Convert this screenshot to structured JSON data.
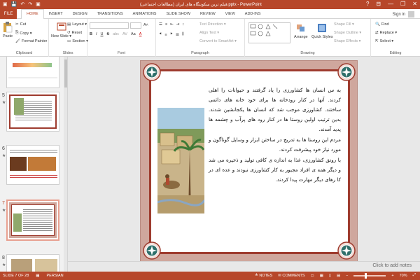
{
  "window": {
    "title": "فیلم ترین سکونتگاه های ایران (مطالعات اجتماعی).pptx - PowerPoint",
    "minimize": "—",
    "restore": "❐",
    "close": "✕",
    "help": "?"
  },
  "qat": {
    "save": "💾",
    "undo": "↶",
    "redo": "↷",
    "present": "▣"
  },
  "tabs": {
    "file": "FILE",
    "items": [
      "HOME",
      "INSERT",
      "DESIGN",
      "TRANSITIONS",
      "ANIMATIONS",
      "SLIDE SHOW",
      "REVIEW",
      "VIEW",
      "ADD-INS"
    ]
  },
  "account": {
    "signin": "Sign in"
  },
  "ribbon": {
    "clipboard": {
      "paste": "Paste",
      "cut": "Cut",
      "copy": "Copy ▾",
      "format_painter": "Format Painter",
      "label": "Clipboard"
    },
    "slides": {
      "new_slide": "New Slide ▾",
      "layout": "Layout ▾",
      "reset": "Reset",
      "section": "Section ▾",
      "label": "Slides"
    },
    "font": {
      "bold": "B",
      "italic": "I",
      "underline": "U",
      "strike": "S",
      "shadow": "abc",
      "spacing": "AV",
      "case": "Aa",
      "color": "A",
      "label": "Font"
    },
    "paragraph": {
      "text_direction": "Text Direction ▾",
      "align_text": "Align Text ▾",
      "smartart": "Convert to SmartArt ▾",
      "label": "Paragraph"
    },
    "drawing": {
      "arrange": "Arrange",
      "quick_styles": "Quick Styles",
      "shape_fill": "Shape Fill ▾",
      "shape_outline": "Shape Outline ▾",
      "shape_effects": "Shape Effects ▾",
      "label": "Drawing"
    },
    "editing": {
      "find": "Find",
      "replace": "Replace ▾",
      "select": "Select ▾",
      "label": "Editing"
    }
  },
  "thumbnails": [
    {
      "num": "5",
      "star": "★"
    },
    {
      "num": "6",
      "star": "★"
    },
    {
      "num": "7",
      "star": "★"
    },
    {
      "num": "8",
      "star": "★"
    }
  ],
  "slide": {
    "paragraphs": [
      "به س انسان ها کشاورزی را یاد گرفتند و حیوانات را اهلی کردند. آنها در کنار رودخانه ها برای خود خانه های دائمی ساختند. کشاورزی موجب شد که انسان ها یکجانشین شدند. بدین ترتیب اولین روستا ها در کنار رود های پرآب و چشمه ها پدید آمدند.",
      "مردم این روستا ها به تدریج در ساختن ابزار و وسایل گوناگون و مورد نیاز خود پیشرفت کردند.",
      "با رونق کشاورزی، غذا به اندازه ی کافی تولید و ذخیره می شد و دیگر همه ی افراد مجبور به کار کشاورزی نبودند و عده ای در کا رهای دیگر مهارت پیدا کردند."
    ]
  },
  "notes": {
    "placeholder": "Click to add notes"
  },
  "status": {
    "slide": "SLIDE 7 OF 28",
    "language": "PERSIAN",
    "notes": "NOTES",
    "comments": "COMMENTS",
    "zoom": "70%"
  },
  "colors": {
    "accent": "#b7472a",
    "slide_border": "#9e3b2e",
    "slide_frame": "#cfa79d"
  }
}
